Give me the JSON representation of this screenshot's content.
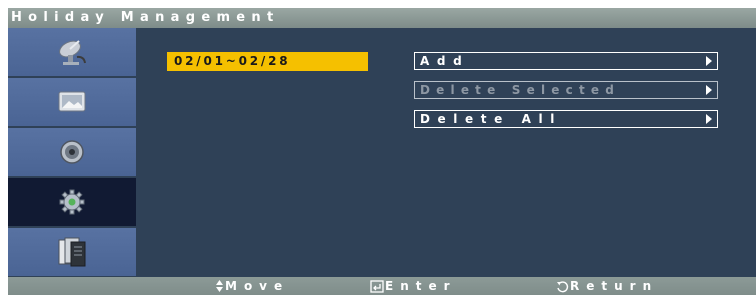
{
  "window": {
    "title": "Holiday Management"
  },
  "sidebar": {
    "items": [
      {
        "icon": "satellite-dish-icon",
        "active": false
      },
      {
        "icon": "picture-icon",
        "active": false
      },
      {
        "icon": "speaker-icon",
        "active": false
      },
      {
        "icon": "gear-icon",
        "active": true
      },
      {
        "icon": "documents-icon",
        "active": false
      }
    ]
  },
  "main": {
    "holiday_range": "02/01~02/28",
    "actions": [
      {
        "label": "Add",
        "enabled": true
      },
      {
        "label": "Delete Selected",
        "enabled": false
      },
      {
        "label": "Delete All",
        "enabled": true
      }
    ]
  },
  "navbar": {
    "move_label": "Move",
    "enter_label": "Enter",
    "return_label": "Return"
  },
  "colors": {
    "title_bar": "#8a9895",
    "panel": "#2f4157",
    "sidebar_item": "#5169a0",
    "sidebar_active": "#111a33",
    "highlight": "#f5c000"
  }
}
